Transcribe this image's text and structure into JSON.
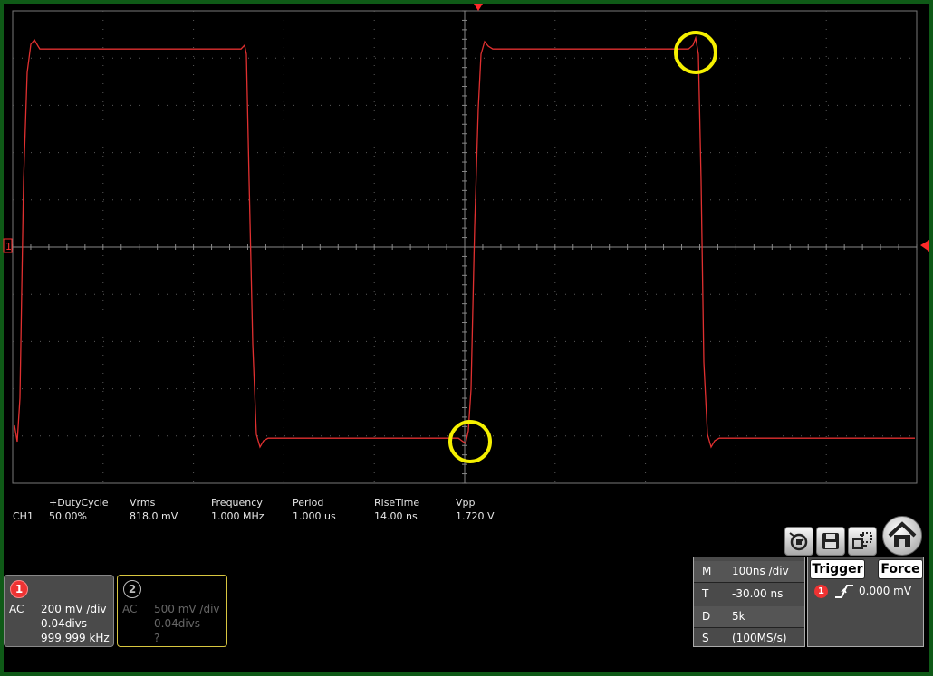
{
  "waveform": {
    "channel_marker": "1",
    "trace_color": "#e03030",
    "highlight_color": "#f5f000",
    "grid": "on",
    "divisions": {
      "horizontal": 10,
      "vertical": 10
    }
  },
  "measurements": {
    "channel": "CH1",
    "items": [
      {
        "label": "+DutyCycle",
        "value": "50.00%"
      },
      {
        "label": "Vrms",
        "value": "818.0 mV"
      },
      {
        "label": "Frequency",
        "value": "1.000 MHz"
      },
      {
        "label": "Period",
        "value": "1.000 us"
      },
      {
        "label": "RiseTime",
        "value": "14.00 ns"
      },
      {
        "label": "Vpp",
        "value": "1.720 V"
      }
    ]
  },
  "channels": [
    {
      "number": "1",
      "coupling": "AC",
      "scale": "200 mV /div",
      "offset": "0.04divs",
      "freq": "999.999 kHz",
      "color": "#e33333"
    },
    {
      "number": "2",
      "coupling": "AC",
      "scale": "500 mV /div",
      "offset": "0.04divs",
      "freq": "?"
    }
  ],
  "toolbar": {
    "icons": [
      "auto-scale-icon",
      "save-icon",
      "display-mode-icon",
      "home-icon"
    ]
  },
  "timebase": {
    "rows": [
      {
        "key": "M",
        "value": "100ns /div"
      },
      {
        "key": "T",
        "value": "-30.00 ns"
      },
      {
        "key": "D",
        "value": "5k"
      },
      {
        "key": "S",
        "value": "(100MS/s)"
      }
    ]
  },
  "trigger": {
    "trigger_label": "Trigger",
    "force_label": "Force",
    "source": "1",
    "edge_icon": "rising-edge-icon",
    "level": "0.000 mV"
  }
}
